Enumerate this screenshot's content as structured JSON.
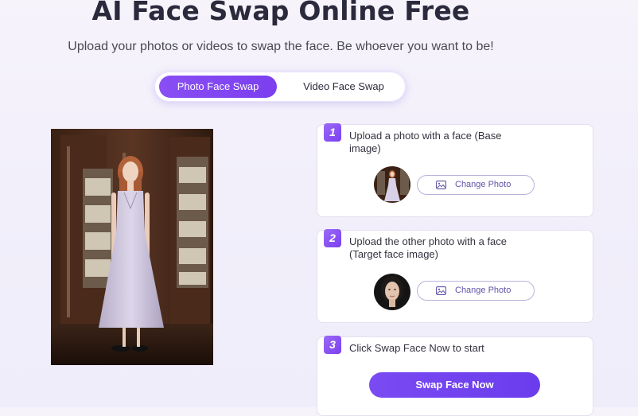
{
  "header": {
    "title": "AI Face Swap Online Free",
    "subtitle": "Upload your photos or videos to swap the face. Be whoever you want to be!"
  },
  "tabs": [
    {
      "label": "Photo Face Swap",
      "active": true
    },
    {
      "label": "Video Face Swap",
      "active": false
    }
  ],
  "steps": [
    {
      "number": "1",
      "text": "Upload a photo with a face (Base image)",
      "button_label": "Change Photo",
      "button_icon": "image-icon"
    },
    {
      "number": "2",
      "text": "Upload the other photo with a face (Target face image)",
      "button_label": "Change Photo",
      "button_icon": "image-icon"
    },
    {
      "number": "3",
      "text": "Click Swap Face Now to start",
      "button_label": "Swap Face Now"
    }
  ],
  "colors": {
    "accent": "#7b3ff0",
    "title": "#2b2a3d",
    "button_border": "#b9b2dc"
  }
}
